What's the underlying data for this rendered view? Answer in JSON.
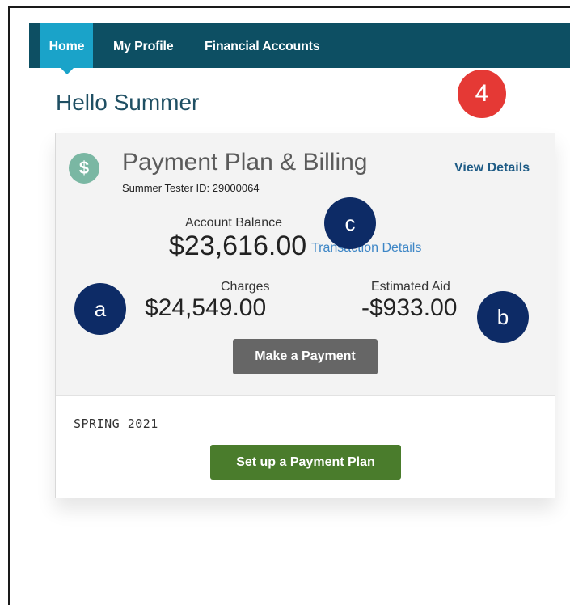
{
  "nav": {
    "items": [
      {
        "label": "Home",
        "active": true
      },
      {
        "label": "My Profile",
        "active": false
      },
      {
        "label": "Financial Accounts",
        "active": false
      }
    ]
  },
  "greeting": "Hello Summer",
  "step_badge": "4",
  "card": {
    "icon": "dollar-icon",
    "icon_glyph": "$",
    "title": "Payment Plan & Billing",
    "subtitle": "Summer Tester ID: 29000064",
    "view_details": "View Details",
    "balance_label": "Account Balance",
    "balance_amount": "$23,616.00",
    "transaction_link": "Transaction Details",
    "charges_label": "Charges",
    "charges_amount": "$24,549.00",
    "aid_label": "Estimated Aid",
    "aid_amount": "-$933.00",
    "pay_button": "Make a Payment",
    "term": "SPRING 2021",
    "plan_button": "Set up a Payment Plan"
  },
  "markers": {
    "a": "a",
    "b": "b",
    "c": "c"
  },
  "colors": {
    "nav_bg": "#0d4f63",
    "nav_active": "#1aa3c9",
    "step_badge": "#e53935",
    "marker": "#0d2b66",
    "pay_button": "#666666",
    "plan_button": "#4a7c2c",
    "link": "#3d86c6"
  }
}
